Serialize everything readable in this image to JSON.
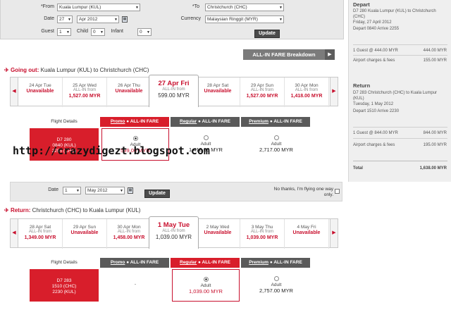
{
  "search": {
    "from_label": "*From",
    "from_value": "Kuala Lumpur (KUL)",
    "to_label": "*To",
    "to_value": "Christchurch (CHC)",
    "date_label": "Date",
    "date_day": "27",
    "date_month": "Apr 2012",
    "currency_label": "Currency",
    "currency_value": "Malaysian Ringgit (MYR)",
    "guest_label": "Guest",
    "guest_value": "1",
    "child_label": "Child",
    "child_value": "0",
    "infant_label": "Infant",
    "infant_value": "0",
    "update_label": "Update"
  },
  "breakdown_label": "ALL-IN FARE Breakdown",
  "outbound": {
    "prefix": "Going out:",
    "route": "Kuala Lumpur (KUL)  to  Christchurch (CHC)",
    "days": [
      {
        "date": "24 Apr Tue",
        "sub": "",
        "price": "Unavailable",
        "selected": false
      },
      {
        "date": "25 Apr Wed",
        "sub": "ALL-IN from",
        "price": "1,527.00 MYR",
        "selected": false
      },
      {
        "date": "26 Apr Thu",
        "sub": "",
        "price": "Unavailable",
        "selected": false
      },
      {
        "date": "27 Apr Fri",
        "sub": "ALL-IN from",
        "price": "599.00 MYR",
        "selected": true
      },
      {
        "date": "28 Apr Sat",
        "sub": "",
        "price": "Unavailable",
        "selected": false
      },
      {
        "date": "29 Apr Sun",
        "sub": "ALL-IN from",
        "price": "1,527.00 MYR",
        "selected": false
      },
      {
        "date": "30 Apr Mon",
        "sub": "ALL-IN from",
        "price": "1,418.00 MYR",
        "selected": false
      }
    ],
    "flight_details_label": "Flight Details",
    "promo_label": "Promo",
    "regular_label": "Regular",
    "premium_label": "Premium",
    "allin_label": "ALL-IN FARE",
    "flight": {
      "code": "D7  280",
      "dep": "0840  (KUL)",
      "arr": "2255  (CHC)"
    },
    "fares": [
      {
        "type": "Adult",
        "price": "599.00 MYR",
        "selected": true
      },
      {
        "type": "Adult",
        "price": "1,418.00 MYR",
        "selected": false
      },
      {
        "type": "Adult",
        "price": "2,717.00 MYR",
        "selected": false
      }
    ]
  },
  "watermark": "http://crazydigezt.blogspot.com",
  "return_search": {
    "date_label": "Date",
    "date_day": "1",
    "date_month": "May 2012",
    "update_label": "Update",
    "no_thanks": "No thanks, I'm flying one way only."
  },
  "inbound": {
    "prefix": "Return:",
    "route": "Christchurch (CHC)  to  Kuala Lumpur (KUL)",
    "days": [
      {
        "date": "28 Apr Sat",
        "sub": "ALL-IN from",
        "price": "1,349.00 MYR",
        "selected": false
      },
      {
        "date": "29 Apr Sun",
        "sub": "",
        "price": "Unavailable",
        "selected": false
      },
      {
        "date": "30 Apr Mon",
        "sub": "ALL-IN from",
        "price": "1,458.00 MYR",
        "selected": false
      },
      {
        "date": "1 May Tue",
        "sub": "ALL-IN from",
        "price": "1,039.00 MYR",
        "selected": true
      },
      {
        "date": "2 May Wed",
        "sub": "",
        "price": "Unavailable",
        "selected": false
      },
      {
        "date": "3 May Thu",
        "sub": "ALL-IN from",
        "price": "1,039.00 MYR",
        "selected": false
      },
      {
        "date": "4 May Fri",
        "sub": "",
        "price": "Unavailable",
        "selected": false
      }
    ],
    "flight_details_label": "Flight Details",
    "promo_label": "Promo",
    "regular_label": "Regular",
    "premium_label": "Premium",
    "allin_label": "ALL-IN FARE",
    "flight": {
      "code": "D7  283",
      "dep": "1510  (CHC)",
      "arr": "2230  (KUL)"
    },
    "promo_empty": "-",
    "fares": [
      {
        "type": "Adult",
        "price": "1,039.00 MYR",
        "selected": true
      },
      {
        "type": "Adult",
        "price": "2,757.00 MYR",
        "selected": false
      }
    ]
  },
  "summary": {
    "depart_title": "Depart",
    "depart_flight": "D7 280  Kuala Lumpur (KUL) to Christchurch (CHC)",
    "depart_date": "Friday, 27 April 2012",
    "depart_time": "Depart  0840  Arrive  2255",
    "depart_guest_label": "1 Guest @ 444.00 MYR",
    "depart_guest_value": "444.00 MYR",
    "depart_fees_label": "Airport charges & fees",
    "depart_fees_value": "155.00 MYR",
    "return_title": "Return",
    "return_flight": "D7 283  Christchurch (CHC) to Kuala Lumpur (KUL)",
    "return_date": "Tuesday, 1 May 2012",
    "return_time": "Depart  1510  Arrive  2230",
    "return_guest_label": "1 Guest @ 844.00 MYR",
    "return_guest_value": "844.00 MYR",
    "return_fees_label": "Airport charges & fees",
    "return_fees_value": "195.00 MYR",
    "total_label": "Total",
    "total_value": "1,638.00 MYR"
  },
  "colors": {
    "brand_red": "#d81e2b",
    "regular_red": "#c8102e",
    "promo_grey": "#5a5a5a"
  }
}
